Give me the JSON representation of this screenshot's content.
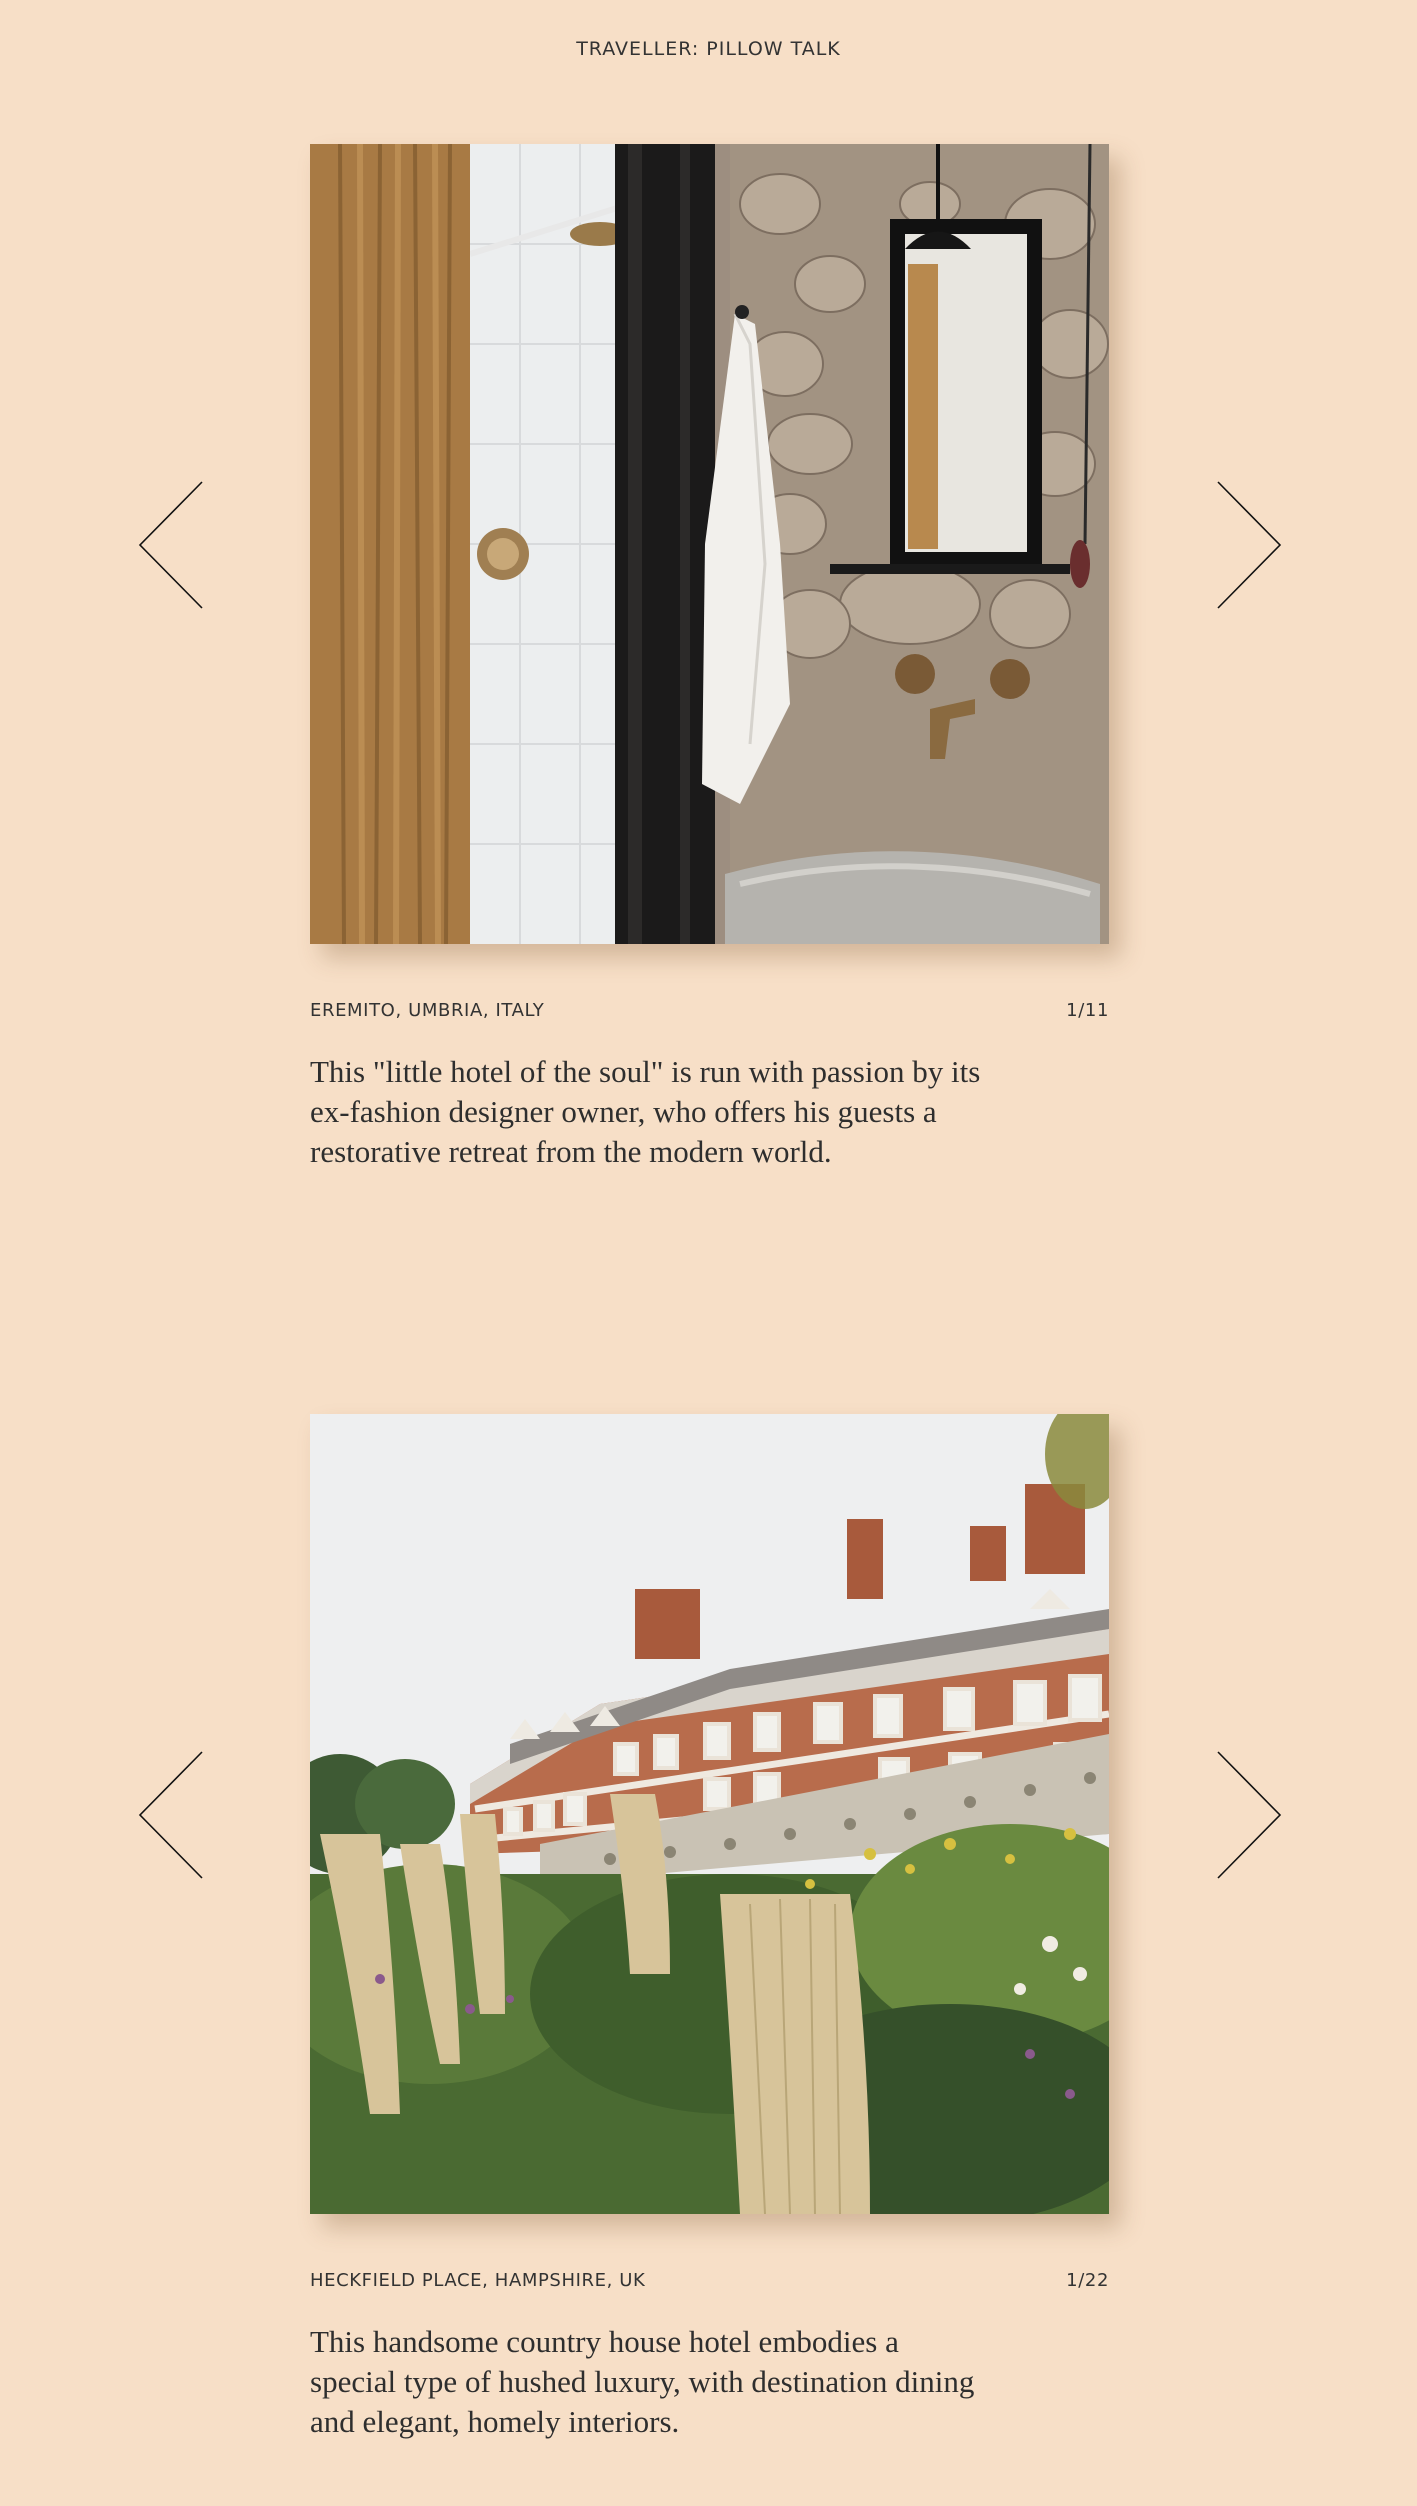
{
  "header": {
    "title": "TRAVELLER: PILLOW TALK"
  },
  "icons": {
    "prev": "chevron-left-icon",
    "next": "chevron-right-icon"
  },
  "colors": {
    "background": "#f7dfc7",
    "text": "#2b2b2b"
  },
  "slides": [
    {
      "location": "EREMITO, UMBRIA, ITALY",
      "counter": "1/11",
      "description": "This \"little hotel of the soul\" is run with passion by its ex-fashion designer owner, who offers his guests a restorative retreat from the modern world."
    },
    {
      "location": "HECKFIELD PLACE, HAMPSHIRE, UK",
      "counter": "1/22",
      "description": "This handsome country house hotel embodies a special type of hushed luxury, with destination dining and elegant, homely interiors."
    }
  ]
}
